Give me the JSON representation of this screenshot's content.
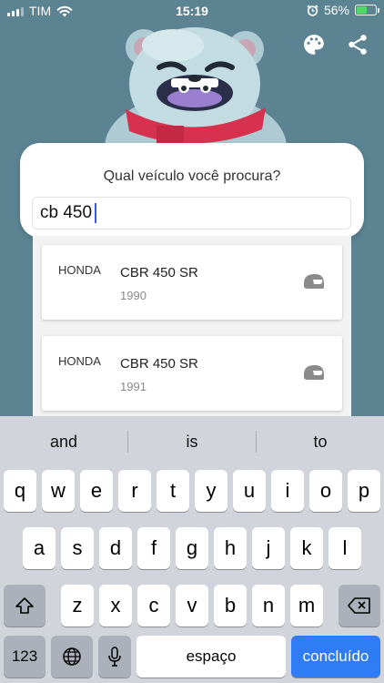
{
  "status_bar": {
    "carrier": "TIM",
    "time": "15:19",
    "battery_percent": "56%",
    "battery_level": 0.56,
    "icons": [
      "signal-icon",
      "wifi-icon",
      "alarm-icon",
      "battery-charging-icon"
    ]
  },
  "header": {
    "actions": [
      {
        "name": "palette-button",
        "icon": "palette-icon"
      },
      {
        "name": "share-button",
        "icon": "share-icon"
      }
    ]
  },
  "search": {
    "title": "Qual veículo você procura?",
    "value": "cb 450"
  },
  "results": [
    {
      "brand": "HONDA",
      "model": "CBR 450 SR",
      "year": "1990",
      "icon": "helmet-icon"
    },
    {
      "brand": "HONDA",
      "model": "CBR 450 SR",
      "year": "1991",
      "icon": "helmet-icon"
    }
  ],
  "keyboard": {
    "suggestions": [
      "and",
      "is",
      "to"
    ],
    "row1": [
      "q",
      "w",
      "e",
      "r",
      "t",
      "y",
      "u",
      "i",
      "o",
      "p"
    ],
    "row2": [
      "a",
      "s",
      "d",
      "f",
      "g",
      "h",
      "j",
      "k",
      "l"
    ],
    "row3": [
      "z",
      "x",
      "c",
      "v",
      "b",
      "n",
      "m"
    ],
    "numbers_label": "123",
    "space_label": "espaço",
    "done_label": "concluído",
    "done_color": "#2f7cf6"
  }
}
